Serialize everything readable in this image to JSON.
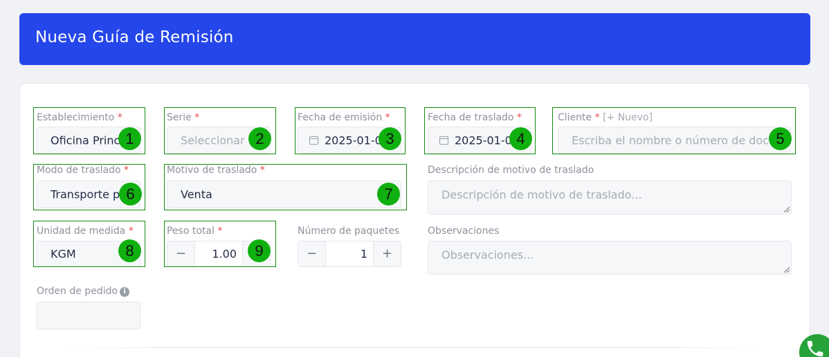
{
  "header": {
    "title": "Nueva Guía de Remisión"
  },
  "form": {
    "establecimiento": {
      "label": "Establecimiento",
      "value": "Oficina Principal",
      "badge": "1"
    },
    "serie": {
      "label": "Serie",
      "placeholder": "Seleccionar",
      "badge": "2"
    },
    "fecha_emision": {
      "label": "Fecha de emisión",
      "value": "2025-01-09",
      "badge": "3"
    },
    "fecha_traslado": {
      "label": "Fecha de traslado",
      "value": "2025-01-09",
      "badge": "4"
    },
    "cliente": {
      "label": "Cliente",
      "new_link": "[+ Nuevo]",
      "placeholder": "Escriba el nombre o número de documento",
      "badge": "5"
    },
    "modo_traslado": {
      "label": "Modo de traslado",
      "value": "Transporte privado",
      "badge": "6"
    },
    "motivo_traslado": {
      "label": "Motivo de traslado",
      "value": "Venta",
      "badge": "7"
    },
    "descripcion_motivo": {
      "label": "Descripción de motivo de traslado",
      "placeholder": "Descripción de motivo de traslado..."
    },
    "unidad_medida": {
      "label": "Unidad de medida",
      "value": "KGM",
      "badge": "8"
    },
    "peso_total": {
      "label": "Peso total",
      "value": "1.00",
      "badge": "9"
    },
    "numero_paquetes": {
      "label": "Número de paquetes",
      "value": "1"
    },
    "observaciones": {
      "label": "Observaciones",
      "placeholder": "Observaciones..."
    },
    "orden_pedido": {
      "label": "Orden de pedido"
    }
  },
  "required_mark": "*",
  "stepper": {
    "minus": "−",
    "plus": "+"
  },
  "colors": {
    "header": "#2446ea",
    "highlight": "#0e8a0e",
    "badge": "#0fb00f",
    "required": "#e5484d"
  },
  "icons": [
    "calendar-icon",
    "info-icon",
    "whatsapp-icon"
  ]
}
